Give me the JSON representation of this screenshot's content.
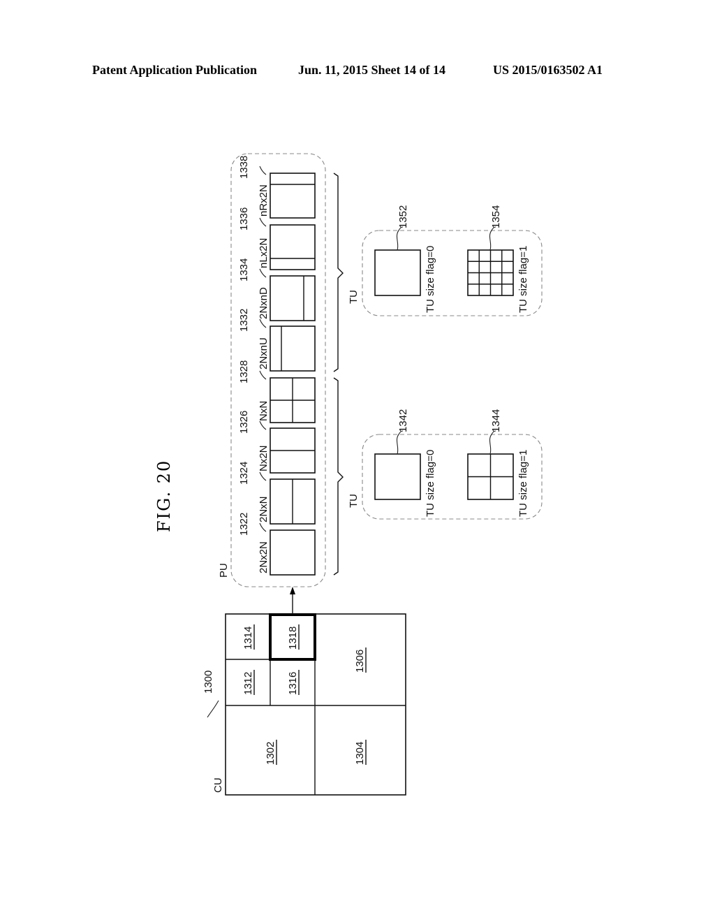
{
  "header": {
    "left": "Patent Application Publication",
    "middle": "Jun. 11, 2015  Sheet 14 of 14",
    "right": "US 2015/0163502 A1"
  },
  "figure": {
    "title": "FIG. 20",
    "cu": {
      "label": "CU",
      "ref": "1300",
      "blocks": {
        "b1302": "1302",
        "b1304": "1304",
        "b1306": "1306",
        "b1312": "1312",
        "b1314": "1314",
        "b1316": "1316",
        "b1318": "1318"
      },
      "highlighted_block": "1318"
    },
    "pu": {
      "label": "PU",
      "partitions": [
        {
          "name": "2Nx2N",
          "ref": "1322"
        },
        {
          "name": "2NxN",
          "ref": "1324"
        },
        {
          "name": "Nx2N",
          "ref": "1326"
        },
        {
          "name": "NxN",
          "ref": "1328"
        },
        {
          "name": "2NxnU",
          "ref": "1332"
        },
        {
          "name": "2NxnD",
          "ref": "1334"
        },
        {
          "name": "nLx2N",
          "ref": "1336"
        },
        {
          "name": "nRx2N",
          "ref": "1338"
        }
      ]
    },
    "tu_groups": [
      {
        "label": "TU",
        "items": [
          {
            "ref": "1342",
            "caption": "TU size flag=0",
            "split": 1
          },
          {
            "ref": "1344",
            "caption": "TU size flag=1",
            "split": 2
          }
        ]
      },
      {
        "label": "TU",
        "items": [
          {
            "ref": "1352",
            "caption": "TU size flag=0",
            "split": 1
          },
          {
            "ref": "1354",
            "caption": "TU size flag=1",
            "split": 4
          }
        ]
      }
    ]
  }
}
